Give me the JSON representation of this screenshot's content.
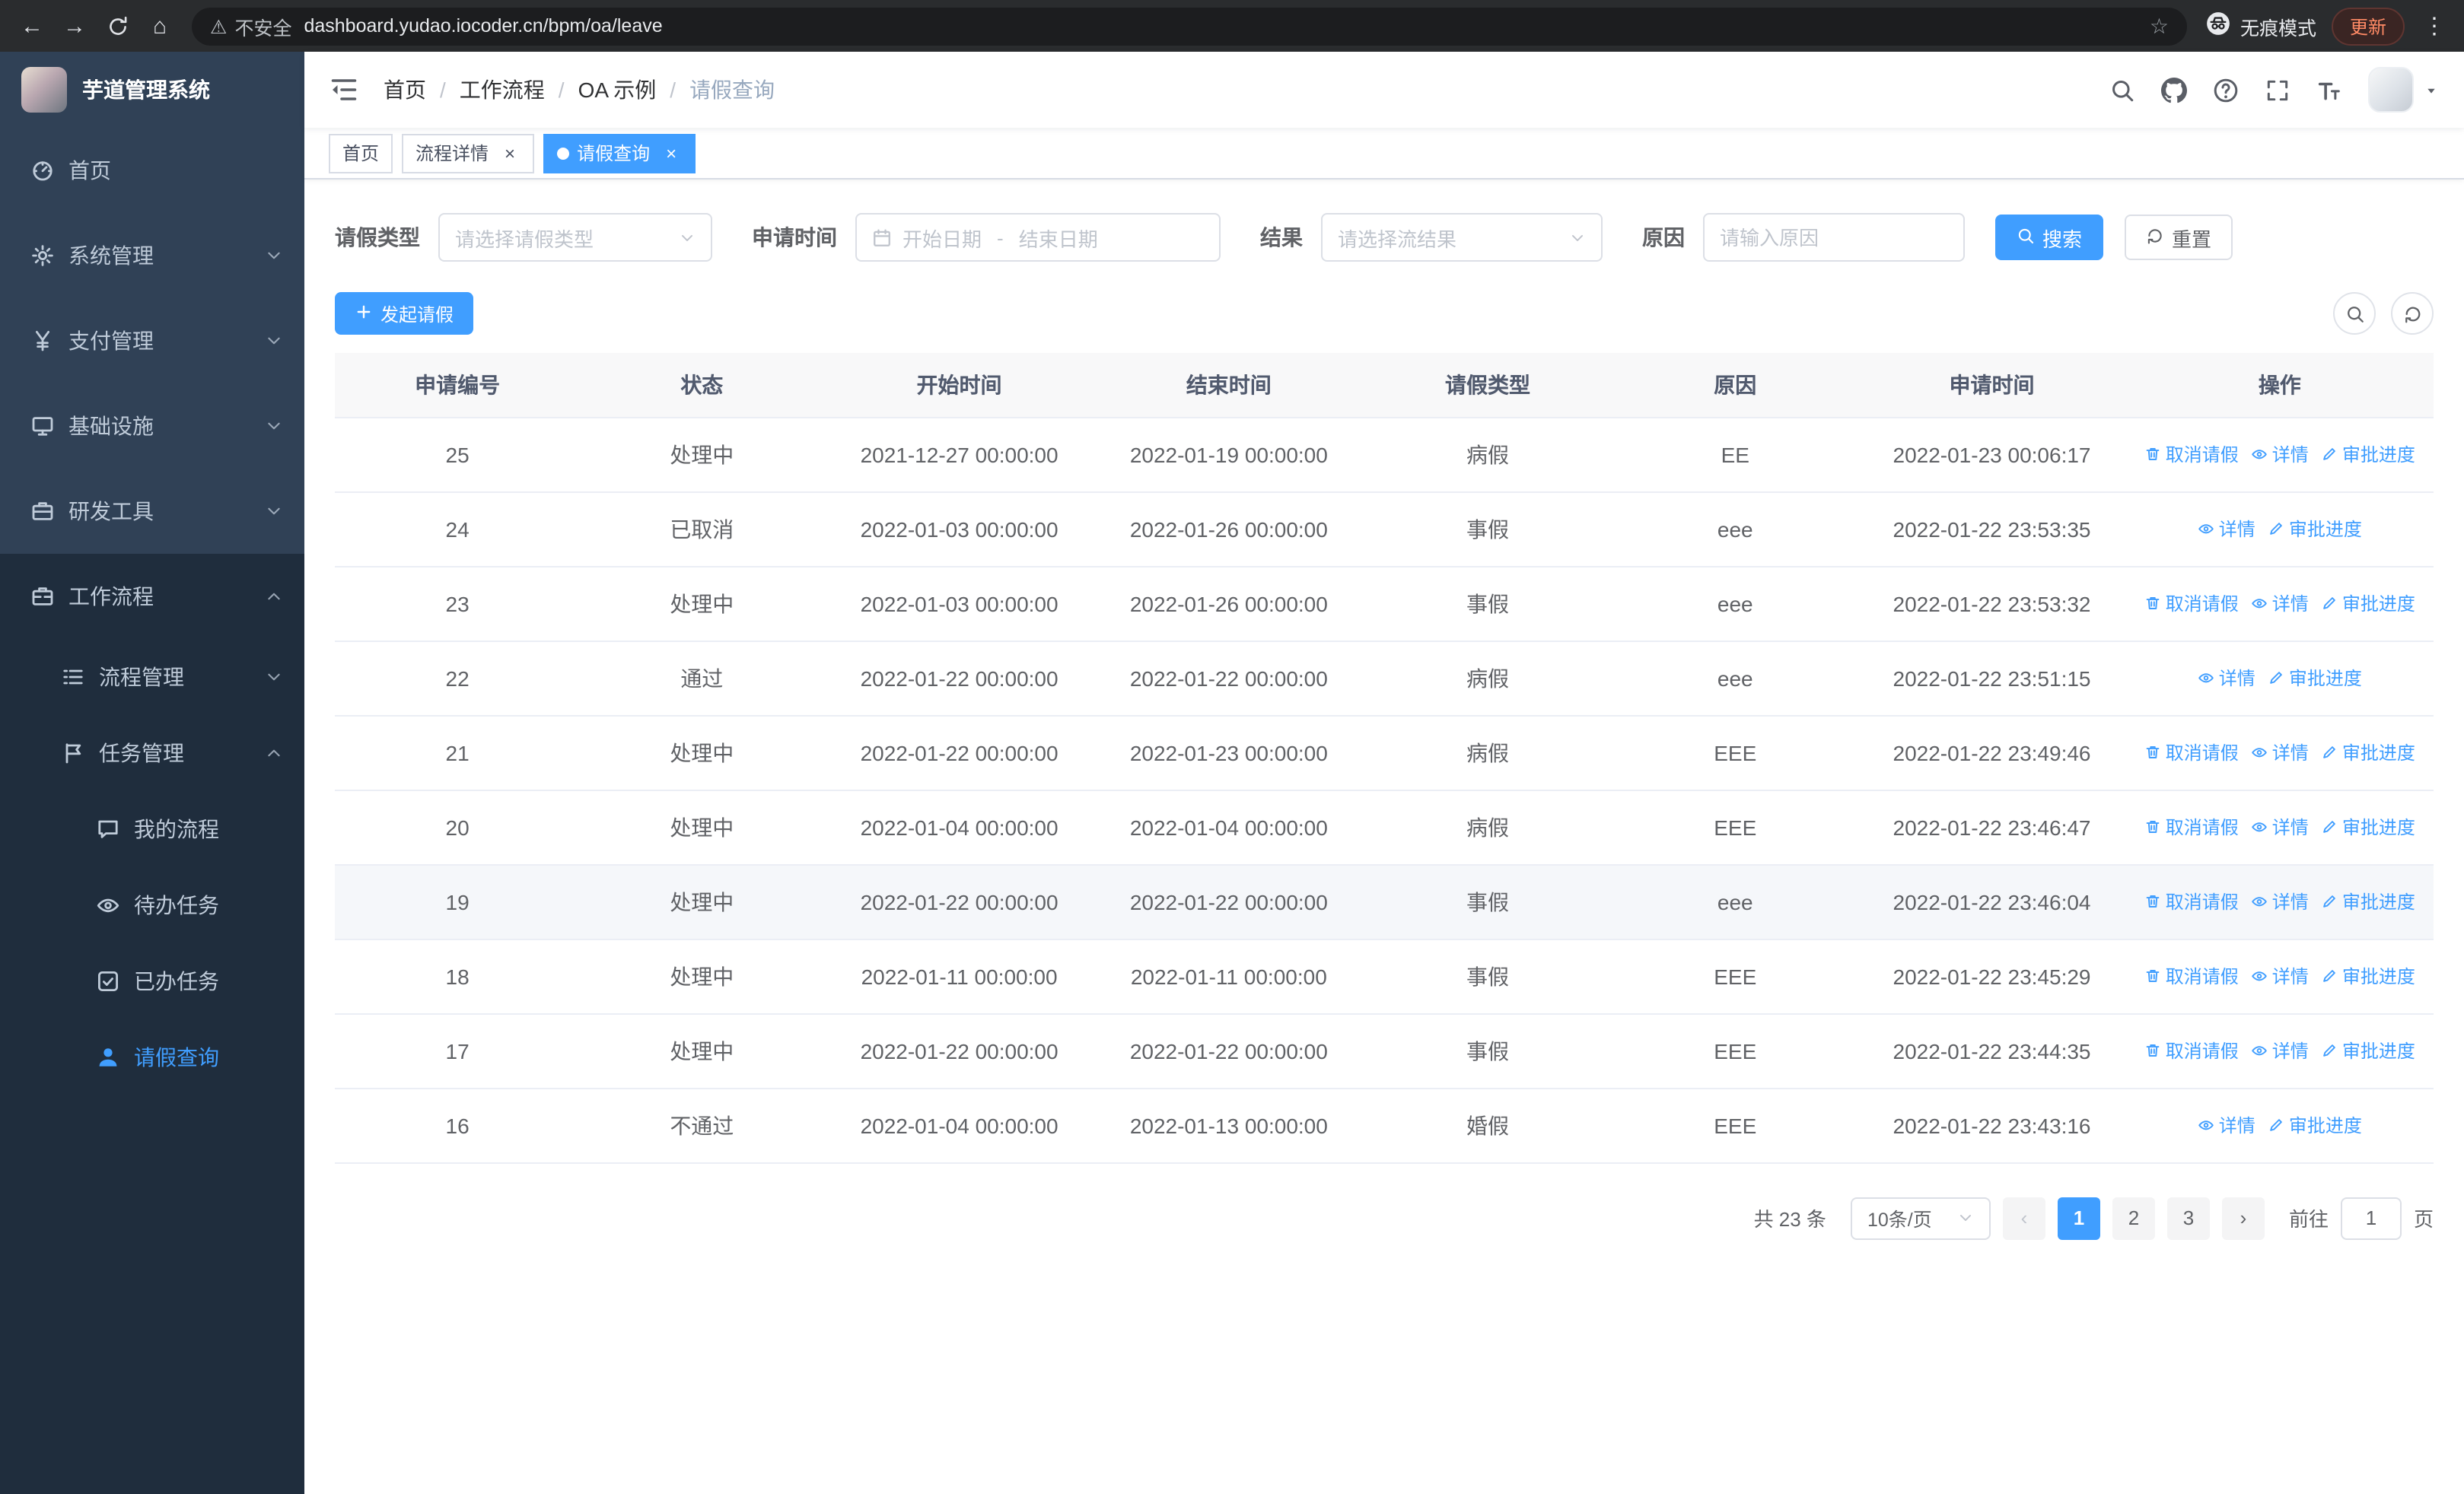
{
  "colors": {
    "primary": "#409eff",
    "sidebar_bg": "#304156",
    "sidebar_submenu_bg": "#1f2d3d",
    "sidebar_text": "#bfcbd9",
    "table_header_bg": "#f8f8f9",
    "update_pill_text": "#ff8a65"
  },
  "browser": {
    "url": "dashboard.yudao.iocoder.cn/bpm/oa/leave",
    "security_warning": "不安全",
    "incognito_label": "无痕模式",
    "update_label": "更新"
  },
  "sidebar": {
    "logo_title": "芋道管理系统",
    "items": [
      {
        "key": "home",
        "label": "首页",
        "icon": "dashboard-icon",
        "level": 1
      },
      {
        "key": "system",
        "label": "系统管理",
        "icon": "gear-icon",
        "level": 1,
        "chevron": "down"
      },
      {
        "key": "payment",
        "label": "支付管理",
        "icon": "yen-icon",
        "level": 1,
        "chevron": "down"
      },
      {
        "key": "infrastructure",
        "label": "基础设施",
        "icon": "monitor-icon",
        "level": 1,
        "chevron": "down"
      },
      {
        "key": "devtools",
        "label": "研发工具",
        "icon": "toolbox-icon",
        "level": 1,
        "chevron": "down"
      },
      {
        "key": "workflow",
        "label": "工作流程",
        "icon": "briefcase-icon",
        "level": 1,
        "chevron": "up",
        "open": true
      },
      {
        "key": "process-management",
        "label": "流程管理",
        "icon": "list-icon",
        "level": 2,
        "chevron": "down"
      },
      {
        "key": "task-management",
        "label": "任务管理",
        "icon": "tasks-icon",
        "level": 2,
        "chevron": "up"
      },
      {
        "key": "my-process",
        "label": "我的流程",
        "icon": "chat-icon",
        "level": 3
      },
      {
        "key": "todo-tasks",
        "label": "待办任务",
        "icon": "eye-icon",
        "level": 3
      },
      {
        "key": "done-tasks",
        "label": "已办任务",
        "icon": "done-icon",
        "level": 3
      },
      {
        "key": "leave-query",
        "label": "请假查询",
        "icon": "user-icon",
        "level": 3,
        "active": true
      }
    ]
  },
  "header": {
    "breadcrumb": [
      "首页",
      "工作流程",
      "OA 示例",
      "请假查询"
    ]
  },
  "tabs": [
    {
      "key": "home",
      "label": "首页"
    },
    {
      "key": "process-detail",
      "label": "流程详情",
      "closable": true
    },
    {
      "key": "leave-query",
      "label": "请假查询",
      "closable": true,
      "active": true
    }
  ],
  "filters": {
    "leave_type_label": "请假类型",
    "leave_type_placeholder": "请选择请假类型",
    "apply_time_label": "申请时间",
    "start_date_placeholder": "开始日期",
    "date_separator": "-",
    "end_date_placeholder": "结束日期",
    "result_label": "结果",
    "result_placeholder": "请选择流结果",
    "reason_label": "原因",
    "reason_placeholder": "请输入原因",
    "search_label": "搜索",
    "reset_label": "重置"
  },
  "toolbar": {
    "create_label": "发起请假"
  },
  "table": {
    "columns": [
      "申请编号",
      "状态",
      "开始时间",
      "结束时间",
      "请假类型",
      "原因",
      "申请时间",
      "操作"
    ],
    "action_labels": {
      "cancel": "取消请假",
      "detail": "详情",
      "progress": "审批进度"
    },
    "rows": [
      {
        "id": "25",
        "status": "处理中",
        "start": "2021-12-27 00:00:00",
        "end": "2022-01-19 00:00:00",
        "type": "病假",
        "reason": "EE",
        "apply_time": "2022-01-23 00:06:17",
        "actions": [
          "cancel",
          "detail",
          "progress"
        ]
      },
      {
        "id": "24",
        "status": "已取消",
        "start": "2022-01-03 00:00:00",
        "end": "2022-01-26 00:00:00",
        "type": "事假",
        "reason": "eee",
        "apply_time": "2022-01-22 23:53:35",
        "actions": [
          "detail",
          "progress"
        ]
      },
      {
        "id": "23",
        "status": "处理中",
        "start": "2022-01-03 00:00:00",
        "end": "2022-01-26 00:00:00",
        "type": "事假",
        "reason": "eee",
        "apply_time": "2022-01-22 23:53:32",
        "actions": [
          "cancel",
          "detail",
          "progress"
        ]
      },
      {
        "id": "22",
        "status": "通过",
        "start": "2022-01-22 00:00:00",
        "end": "2022-01-22 00:00:00",
        "type": "病假",
        "reason": "eee",
        "apply_time": "2022-01-22 23:51:15",
        "actions": [
          "detail",
          "progress"
        ]
      },
      {
        "id": "21",
        "status": "处理中",
        "start": "2022-01-22 00:00:00",
        "end": "2022-01-23 00:00:00",
        "type": "病假",
        "reason": "EEE",
        "apply_time": "2022-01-22 23:49:46",
        "actions": [
          "cancel",
          "detail",
          "progress"
        ]
      },
      {
        "id": "20",
        "status": "处理中",
        "start": "2022-01-04 00:00:00",
        "end": "2022-01-04 00:00:00",
        "type": "病假",
        "reason": "EEE",
        "apply_time": "2022-01-22 23:46:47",
        "actions": [
          "cancel",
          "detail",
          "progress"
        ]
      },
      {
        "id": "19",
        "status": "处理中",
        "start": "2022-01-22 00:00:00",
        "end": "2022-01-22 00:00:00",
        "type": "事假",
        "reason": "eee",
        "apply_time": "2022-01-22 23:46:04",
        "actions": [
          "cancel",
          "detail",
          "progress"
        ],
        "highlighted": true
      },
      {
        "id": "18",
        "status": "处理中",
        "start": "2022-01-11 00:00:00",
        "end": "2022-01-11 00:00:00",
        "type": "事假",
        "reason": "EEE",
        "apply_time": "2022-01-22 23:45:29",
        "actions": [
          "cancel",
          "detail",
          "progress"
        ]
      },
      {
        "id": "17",
        "status": "处理中",
        "start": "2022-01-22 00:00:00",
        "end": "2022-01-22 00:00:00",
        "type": "事假",
        "reason": "EEE",
        "apply_time": "2022-01-22 23:44:35",
        "actions": [
          "cancel",
          "detail",
          "progress"
        ]
      },
      {
        "id": "16",
        "status": "不通过",
        "start": "2022-01-04 00:00:00",
        "end": "2022-01-13 00:00:00",
        "type": "婚假",
        "reason": "EEE",
        "apply_time": "2022-01-22 23:43:16",
        "actions": [
          "detail",
          "progress"
        ]
      }
    ]
  },
  "pagination": {
    "total_label": "共 23 条",
    "page_size_label": "10条/页",
    "pages": [
      "1",
      "2",
      "3"
    ],
    "active_page": "1",
    "goto_label": "前往",
    "goto_value": "1",
    "goto_suffix_label": "页"
  }
}
